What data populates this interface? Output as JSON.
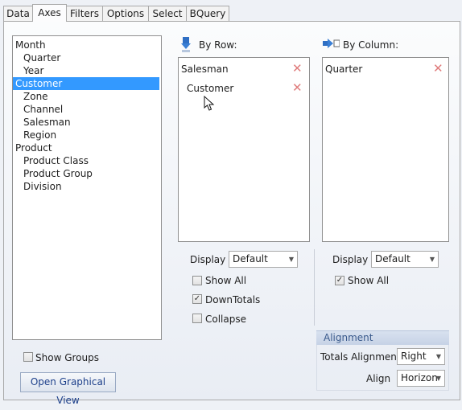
{
  "tabs": [
    "Data",
    "Axes",
    "Filters",
    "Options",
    "Select",
    "BQuery"
  ],
  "fields": [
    {
      "label": "Month",
      "indent": 0
    },
    {
      "label": "Quarter",
      "indent": 1
    },
    {
      "label": "Year",
      "indent": 1
    },
    {
      "label": "Customer",
      "indent": 0,
      "selected": true
    },
    {
      "label": "Zone",
      "indent": 1
    },
    {
      "label": "Channel",
      "indent": 1
    },
    {
      "label": "Salesman",
      "indent": 1
    },
    {
      "label": "Region",
      "indent": 1
    },
    {
      "label": "Product",
      "indent": 0
    },
    {
      "label": "Product Class",
      "indent": 1
    },
    {
      "label": "Product Group",
      "indent": 1
    },
    {
      "label": "Division",
      "indent": 1
    }
  ],
  "by_row": {
    "title": "By Row:",
    "items": [
      "Salesman",
      "Customer"
    ],
    "display_label": "Display",
    "display_value": "Default",
    "show_all": {
      "label": "Show All",
      "checked": false
    },
    "down_totals": {
      "label": "DownTotals",
      "checked": true
    },
    "collapse": {
      "label": "Collapse",
      "checked": false
    }
  },
  "by_column": {
    "title": "By Column:",
    "items": [
      "Quarter"
    ],
    "display_label": "Display",
    "display_value": "Default",
    "show_all": {
      "label": "Show All",
      "checked": true
    }
  },
  "alignment": {
    "header": "Alignment",
    "totals_label": "Totals Alignment",
    "totals_value": "Right",
    "align_label": "Align",
    "align_value": "Horizon"
  },
  "show_groups": {
    "label": "Show Groups",
    "checked": false
  },
  "open_graphical_view": "Open Graphical View",
  "icons": {
    "remove": "x-icon",
    "row_axis": "arrow-down-icon",
    "column_axis": "arrow-right-icon",
    "dropdown": "chevron-down-icon",
    "cursor": "mouse-pointer-icon"
  },
  "colors": {
    "selection": "#3399ff",
    "remove_icon": "#e07d7d",
    "axis_icon": "#3a7fd5",
    "link_text": "#1c3f8a"
  }
}
